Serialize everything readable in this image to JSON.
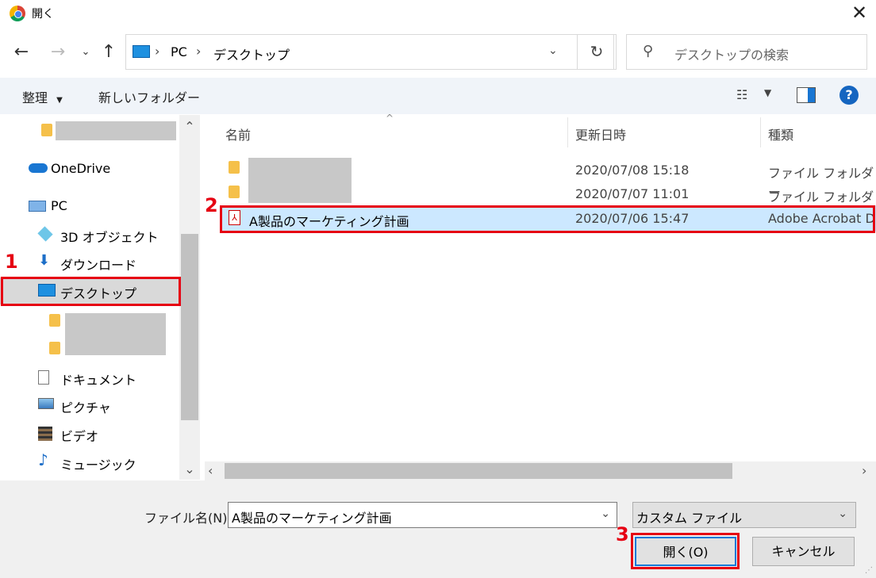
{
  "window": {
    "title": "開く"
  },
  "address": {
    "crumbs": [
      "PC",
      "デスクトップ"
    ],
    "search_placeholder": "デスクトップの検索"
  },
  "toolbar": {
    "organize": "整理",
    "new_folder": "新しいフォルダー",
    "help": "?"
  },
  "sidebar": {
    "items": [
      {
        "label": "OneDrive",
        "icon": "onedrive-icon"
      },
      {
        "label": "PC",
        "icon": "pc-icon"
      },
      {
        "label": "3D オブジェクト",
        "icon": "cube-icon"
      },
      {
        "label": "ダウンロード",
        "icon": "download-icon"
      },
      {
        "label": "デスクトップ",
        "icon": "desktop-icon",
        "selected": true
      },
      {
        "label": "ドキュメント",
        "icon": "document-icon"
      },
      {
        "label": "ピクチャ",
        "icon": "picture-icon"
      },
      {
        "label": "ビデオ",
        "icon": "video-icon"
      },
      {
        "label": "ミュージック",
        "icon": "music-icon"
      }
    ]
  },
  "file_list": {
    "columns": [
      "名前",
      "更新日時",
      "種類"
    ],
    "rows": [
      {
        "name": "",
        "date": "2020/07/08 15:18",
        "type": "ファイル フォルダー",
        "icon": "folder-icon"
      },
      {
        "name": "",
        "date": "2020/07/07 11:01",
        "type": "ファイル フォルダー",
        "icon": "folder-icon"
      },
      {
        "name": "A製品のマーケティング計画",
        "date": "2020/07/06 15:47",
        "type": "Adobe Acrobat D",
        "icon": "pdf-icon",
        "selected": true
      }
    ]
  },
  "footer": {
    "filename_label": "ファイル名(N):",
    "filename_value": "A製品のマーケティング計画",
    "filter_value": "カスタム ファイル",
    "open_button": "開く(O)",
    "cancel_button": "キャンセル"
  },
  "annotations": [
    "1",
    "2",
    "3"
  ],
  "colors": {
    "annotation": "#e60012",
    "selection": "#cce8ff",
    "accent": "#0078d7"
  }
}
